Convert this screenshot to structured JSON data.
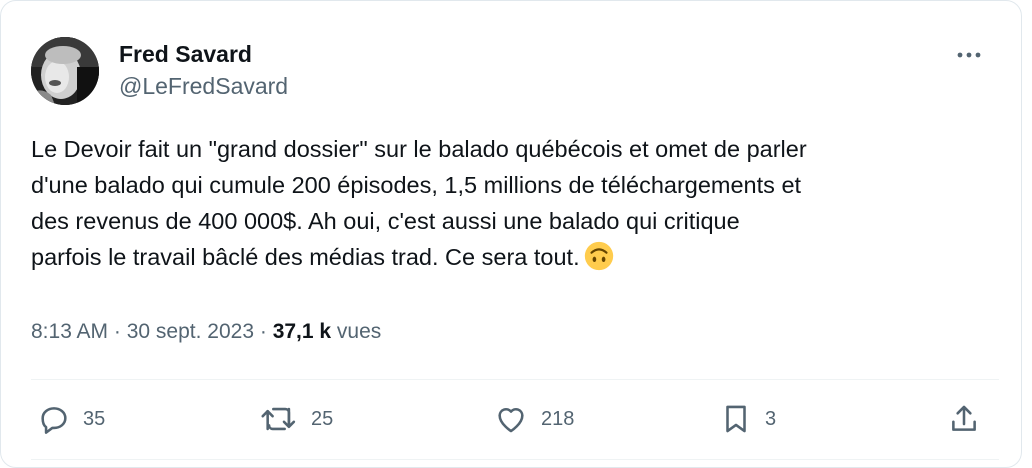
{
  "author": {
    "display_name": "Fred Savard",
    "handle": "@LeFredSavard",
    "avatar_icon": "profile-photo"
  },
  "tweet": {
    "text": "Le Devoir fait un \"grand dossier\" sur le balado québécois et omet de parler\nd'une balado qui cumule 200 épisodes, 1,5 millions de téléchargements et\ndes revenus de 400 000$. Ah oui, c'est aussi une balado qui critique\nparfois le travail bâclé des médias trad. Ce sera tout.",
    "emoji": "upside-down-face"
  },
  "meta": {
    "time": "8:13 AM",
    "separator": " · ",
    "date": "30 sept. 2023",
    "views_count": "37,1 k",
    "views_label": " vues"
  },
  "actions": {
    "replies": "35",
    "retweets": "25",
    "likes": "218",
    "bookmarks": "3"
  },
  "colors": {
    "text": "#0f1419",
    "secondary": "#536471",
    "border": "#e1e8ed",
    "emoji": "#ffcc4d"
  }
}
